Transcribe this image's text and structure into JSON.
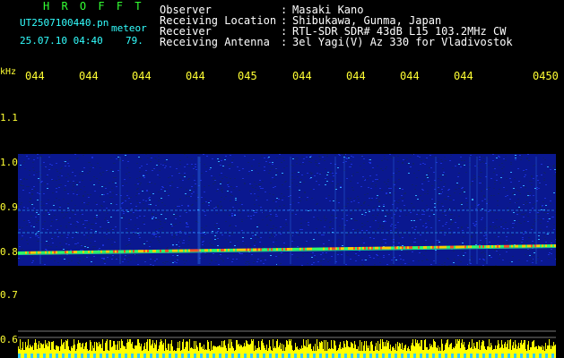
{
  "header": {
    "brand": "H R O F F T",
    "file_name": "UT2507100440.pn",
    "meteor_label": "meteor",
    "timestamp": "25.07.10 04:40",
    "count": "79.",
    "rows": [
      {
        "label": "Observer",
        "value": "Masaki Kano"
      },
      {
        "label": "Receiving Location",
        "value": "Shibukawa, Gunma, Japan"
      },
      {
        "label": "Receiver",
        "value": "RTL-SDR SDR# 43dB L15 103.2MHz CW"
      },
      {
        "label": "Receiving Antenna",
        "value": "3el Yagi(V) Az 330 for Vladivostok"
      }
    ]
  },
  "axis": {
    "unit": "kHz",
    "time_ticks": [
      "044",
      "044",
      "044",
      "044",
      "045",
      "044",
      "044",
      "044",
      "044",
      "0450"
    ],
    "freq_ticks": [
      "1.1",
      "1.0",
      "0.9",
      "0.8",
      "0.7",
      "0.6"
    ]
  },
  "colors": {
    "background": "#000000",
    "noise_band": "#1a2fd6",
    "echo_line": "#ffcc00",
    "activity_bar": "#ffff00"
  }
}
